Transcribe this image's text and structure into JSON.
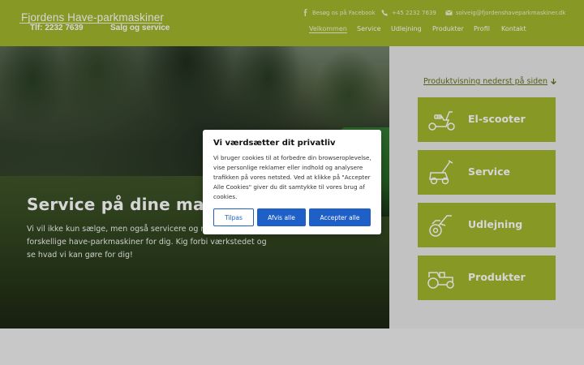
{
  "brand": {
    "name": "Fjordens Have-parkmaskiner",
    "phone": "Tlf: 2232 7639",
    "tagline": "Salg og service"
  },
  "contact": {
    "facebook": "Besøg os på Facebook",
    "phone": "+45 2232 7639",
    "email": "solveig@fjordenshaveparkmaskiner.dk"
  },
  "nav": [
    {
      "label": "Velkommen"
    },
    {
      "label": "Service"
    },
    {
      "label": "Udlejning"
    },
    {
      "label": "Produkter"
    },
    {
      "label": "Profil"
    },
    {
      "label": "Kontakt"
    }
  ],
  "hero": {
    "title": "Service på dine maskiner",
    "text": "Vi vil ikke kun sælge, men også servicere og reparere forskellige have-parkmaskiner for dig. Kig forbi værkstedet og se hvad vi kan gøre for dig!"
  },
  "side": {
    "link": "Produktvisning nederst på siden",
    "tiles": [
      {
        "label": "El-scooter",
        "icon": "scooter-icon"
      },
      {
        "label": "Service",
        "icon": "lawnmower-icon"
      },
      {
        "label": "Udlejning",
        "icon": "tiller-icon"
      },
      {
        "label": "Produkter",
        "icon": "tractor-icon"
      }
    ]
  },
  "cookie": {
    "title": "Vi værdsætter dit privatliv",
    "text": "Vi bruger cookies til at forbedre din browseroplevelse, vise personlige reklamer eller indhold og analysere trafikken på vores netsted. Ved at klikke på \"Accepter Alle Cookies\" giver du dit samtykke til vores brug af cookies.",
    "customize": "Tilpas",
    "reject": "Afvis alle",
    "accept": "Accepter alle"
  },
  "colors": {
    "brand_green": "#9fb426",
    "button_blue": "#1f5fc8"
  }
}
